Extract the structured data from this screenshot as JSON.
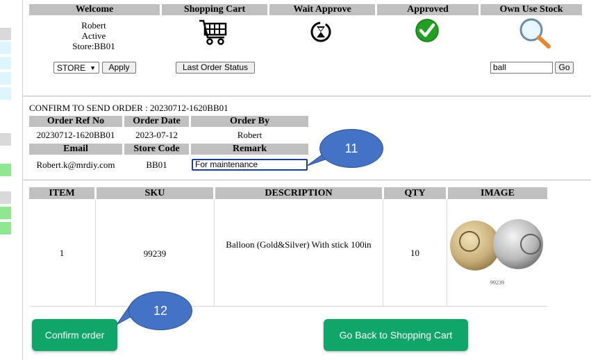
{
  "header": {
    "columns": [
      "Welcome",
      "Shopping Cart",
      "Wait Approve",
      "Approved",
      "Own Use Stock"
    ],
    "user_name": "Robert",
    "user_status": "Active",
    "store_line": "Store:BB01",
    "store_select_value": "STORE",
    "apply_label": "Apply",
    "last_order_label": "Last Order Status",
    "search_value": "ball",
    "go_label": "Go",
    "icons": [
      "shopping-cart-icon",
      "hourglass-icon",
      "checkmark-icon",
      "magnifier-icon"
    ],
    "colors": {
      "header_bg": "#c0c0c0",
      "approved_green": "#22a022",
      "magnifier_handle": "#e8862e"
    }
  },
  "order": {
    "title": "CONFIRM TO SEND ORDER : 20230712-1620BB01",
    "headers_row1": [
      "Order Ref No",
      "Order Date",
      "Order By"
    ],
    "values_row1": [
      "20230712-1620BB01",
      "2023-07-12",
      "Robert"
    ],
    "headers_row2": [
      "Email",
      "Store Code",
      "Remark"
    ],
    "email": "Robert.k@mrdiy.com",
    "store_code": "BB01",
    "remark_value": "For maintenance"
  },
  "items": {
    "headers": [
      "ITEM",
      "SKU",
      "DESCRIPTION",
      "QTY",
      "IMAGE"
    ],
    "rows": [
      {
        "item": "1",
        "sku": "99239",
        "description": "Balloon (Gold&Silver) With stick 100in",
        "qty": "10",
        "image_caption": "99239"
      }
    ]
  },
  "actions": {
    "confirm_label": "Confirm order",
    "back_label": "Go Back to Shopping Cart",
    "button_color": "#10a66a"
  },
  "callouts": [
    "11",
    "12"
  ]
}
